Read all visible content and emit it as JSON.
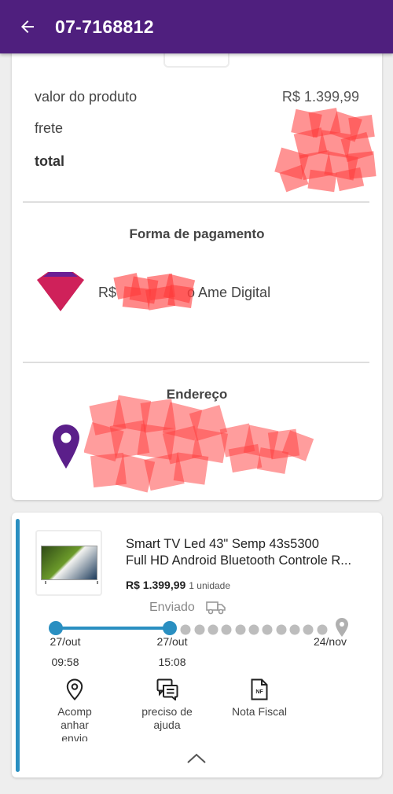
{
  "header": {
    "title": "07-7168812",
    "back_icon": "arrow-left-icon"
  },
  "summary": {
    "product_value_label": "valor do produto",
    "product_value": "R$ 1.399,99",
    "shipping_label": "frete",
    "total_label": "total"
  },
  "payment": {
    "title": "Forma de pagamento",
    "text_prefix": "R$",
    "text_suffix": "o Ame Digital",
    "icon": "ame-logo-icon"
  },
  "address": {
    "title": "Endereço",
    "icon": "location-pin-icon"
  },
  "order_item": {
    "name_line1": "Smart TV Led 43\" Semp 43s5300",
    "name_line2": "Full HD Android Bluetooth Controle R...",
    "price": "R$ 1.399,99",
    "quantity": "1 unidade",
    "status": "Enviado",
    "status_icon": "truck-icon",
    "timeline": {
      "start": {
        "date": "27/out",
        "time": "09:58"
      },
      "middle": {
        "date": "27/out",
        "time": "15:08"
      },
      "end": {
        "date": "24/nov"
      }
    },
    "actions": [
      {
        "label_lines": [
          "Acomp",
          "anhar",
          "envio"
        ],
        "icon": "location-pin-outline-icon"
      },
      {
        "label_lines": [
          "preciso de",
          "ajuda"
        ],
        "icon": "chat-help-icon"
      },
      {
        "label_lines": [
          "Nota Fiscal"
        ],
        "icon": "invoice-nf-icon",
        "icon_text": "NF"
      }
    ],
    "collapse_icon": "chevron-up-icon"
  },
  "colors": {
    "header_bg": "#4f1f7e",
    "accent_blue": "#2a8fc1",
    "pin_purple": "#5b1f8a",
    "redaction": "#ff3b3b"
  }
}
